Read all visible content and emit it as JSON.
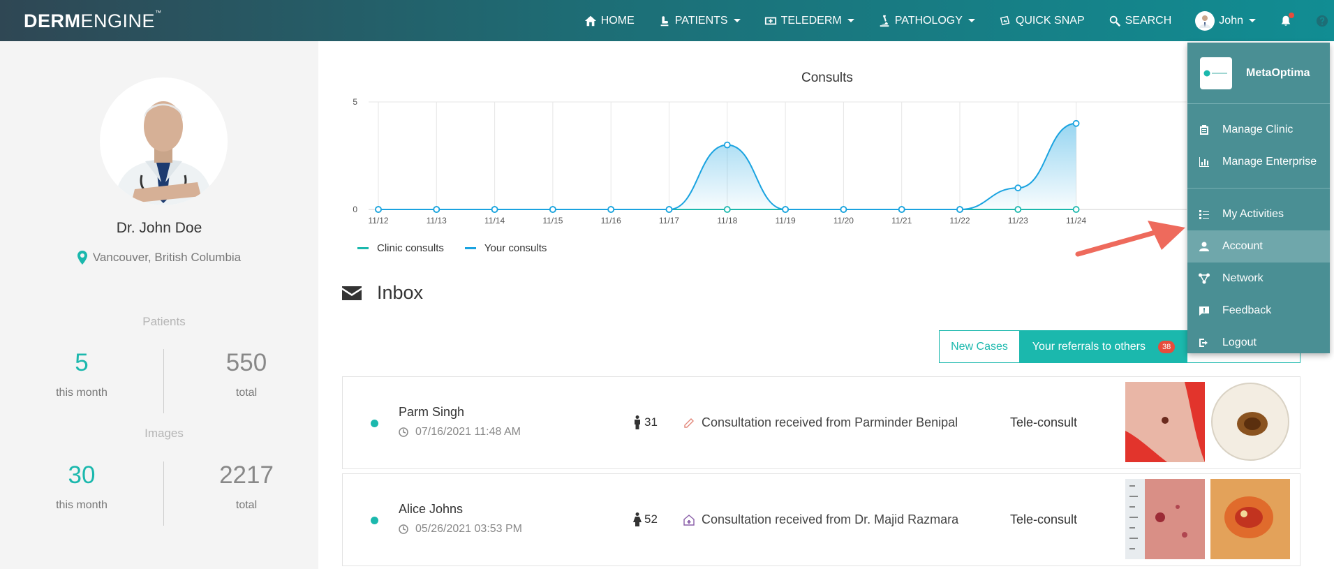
{
  "brand": {
    "bold": "DERM",
    "light": "ENGINE",
    "tm": "™"
  },
  "nav": {
    "home": "HOME",
    "patients": "PATIENTS",
    "telederm": "TELEDERM",
    "pathology": "PATHOLOGY",
    "quick_snap": "QUICK SNAP",
    "search": "SEARCH",
    "user": "John"
  },
  "profile": {
    "name": "Dr. John Doe",
    "location": "Vancouver, British Columbia"
  },
  "stats": {
    "patients": {
      "label": "Patients",
      "month_value": "5",
      "month_label": "this month",
      "total_value": "550",
      "total_label": "total"
    },
    "images": {
      "label": "Images",
      "month_value": "30",
      "month_label": "this month",
      "total_value": "2217",
      "total_label": "total"
    }
  },
  "chart_data": {
    "type": "area",
    "title": "Consults",
    "x": [
      "11/12",
      "11/13",
      "11/14",
      "11/15",
      "11/16",
      "11/17",
      "11/18",
      "11/19",
      "11/20",
      "11/21",
      "11/22",
      "11/23",
      "11/24"
    ],
    "yticks": [
      "0",
      "5"
    ],
    "ylim": [
      0,
      5
    ],
    "series": [
      {
        "name": "Clinic consults",
        "color": "#1bb8ad",
        "values": [
          0,
          0,
          0,
          0,
          0,
          0,
          0,
          0,
          0,
          0,
          0,
          0,
          0
        ]
      },
      {
        "name": "Your consults",
        "color": "#1aa3e0",
        "values": [
          0,
          0,
          0,
          0,
          0,
          0,
          3,
          0,
          0,
          0,
          0,
          1,
          4
        ]
      }
    ],
    "grid": true,
    "legend": "bottom-left"
  },
  "inbox": {
    "title": "Inbox",
    "tabs": {
      "new_cases": "New Cases",
      "referrals": "Your referrals to others",
      "referrals_count": "38"
    },
    "rows": [
      {
        "name": "Parm Singh",
        "date": "07/16/2021 11:48 AM",
        "age": "31",
        "message": "Consultation received from Parminder Benipal",
        "type": "Tele-consult"
      },
      {
        "name": "Alice Johns",
        "date": "05/26/2021 03:53 PM",
        "age": "52",
        "message": "Consultation received from Dr. Majid Razmara",
        "type": "Tele-consult"
      }
    ]
  },
  "user_menu": {
    "org": "MetaOptima",
    "items": [
      "Manage Clinic",
      "Manage Enterprise",
      "My Activities",
      "Account",
      "Network",
      "Feedback",
      "Logout"
    ]
  },
  "colors": {
    "accent": "#1bb8ad",
    "line": "#1aa3e0",
    "badge": "#e74c3c",
    "menu": "#4a8f94"
  }
}
